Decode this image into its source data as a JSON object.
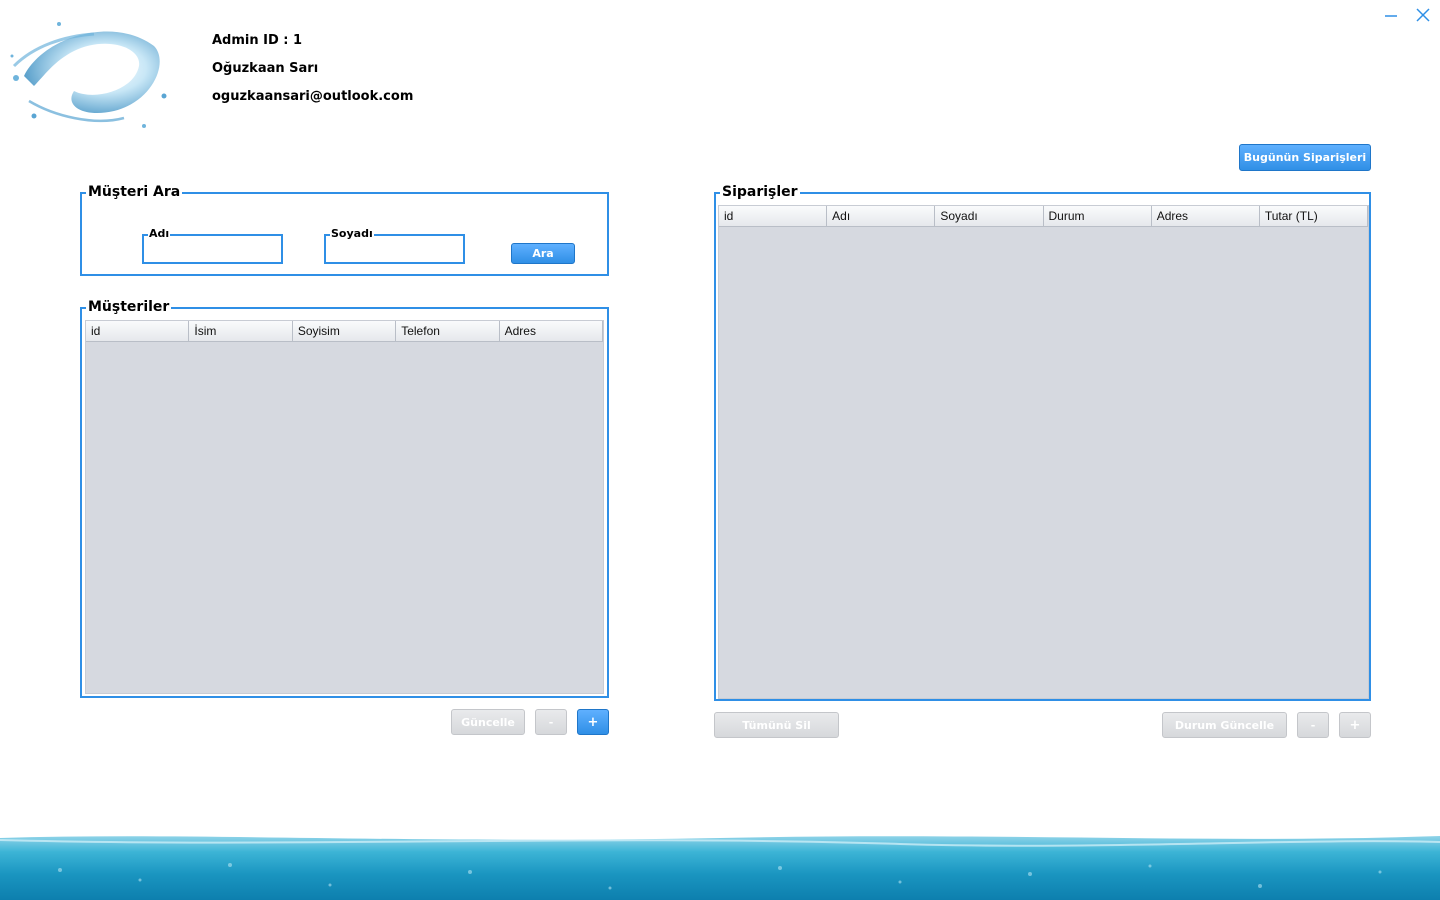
{
  "admin": {
    "id_line": "Admin ID : 1",
    "name": "Oğuzkaan Sarı",
    "email": "oguzkaansari@outlook.com"
  },
  "window": {
    "minimize_icon": "minimize-icon",
    "close_icon": "close-icon"
  },
  "top_button": {
    "label": "Bugünün Siparişleri"
  },
  "search_panel": {
    "title": "Müşteri Ara",
    "first_name_label": "Adı",
    "first_name_value": "",
    "last_name_label": "Soyadı",
    "last_name_value": "",
    "search_button": "Ara"
  },
  "customers_panel": {
    "title": "Müşteriler",
    "columns": [
      "id",
      "İsim",
      "Soyisim",
      "Telefon",
      "Adres"
    ],
    "rows": [],
    "buttons": {
      "update": "Güncelle",
      "remove": "-",
      "add": "+"
    }
  },
  "orders_panel": {
    "title": "Siparişler",
    "columns": [
      "id",
      "Adı",
      "Soyadı",
      "Durum",
      "Adres",
      "Tutar (TL)"
    ],
    "rows": [],
    "buttons": {
      "delete_all": "Tümünü Sil",
      "update_status": "Durum Güncelle",
      "remove": "-",
      "add": "+"
    }
  },
  "colors": {
    "accent": "#2f8fe6",
    "table_bg": "#d6d9e0",
    "disabled_button": "#dcdee1"
  }
}
